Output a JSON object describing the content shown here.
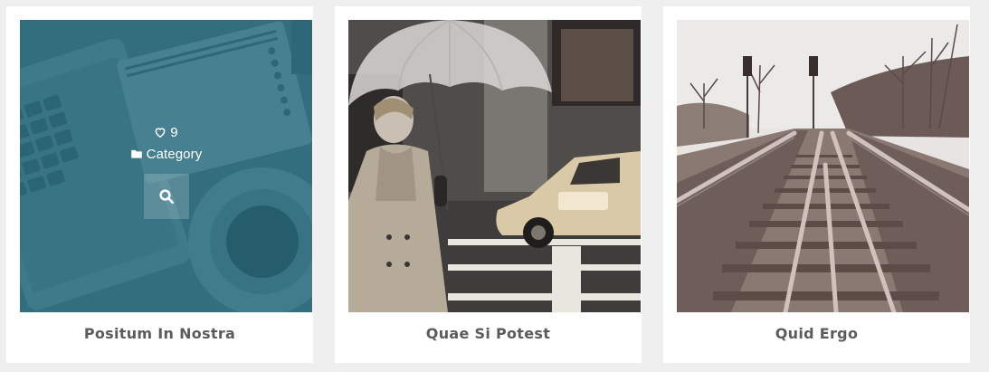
{
  "colors": {
    "page_bg": "#efefef",
    "card_bg": "#ffffff",
    "overlay": "#286e80",
    "title": "#5b5b5b"
  },
  "items": [
    {
      "title": "Positum In Nostra",
      "image": "desk-laptop-notebook-coffee-photo",
      "hover": {
        "likes": "9",
        "category": "Category",
        "like_icon": "heart-outline-icon",
        "category_icon": "folder-icon",
        "zoom_icon": "search-icon"
      }
    },
    {
      "title": "Quae Si Potest",
      "image": "woman-with-umbrella-taxi-street-photo"
    },
    {
      "title": "Quid Ergo",
      "image": "railway-tracks-photo"
    }
  ]
}
